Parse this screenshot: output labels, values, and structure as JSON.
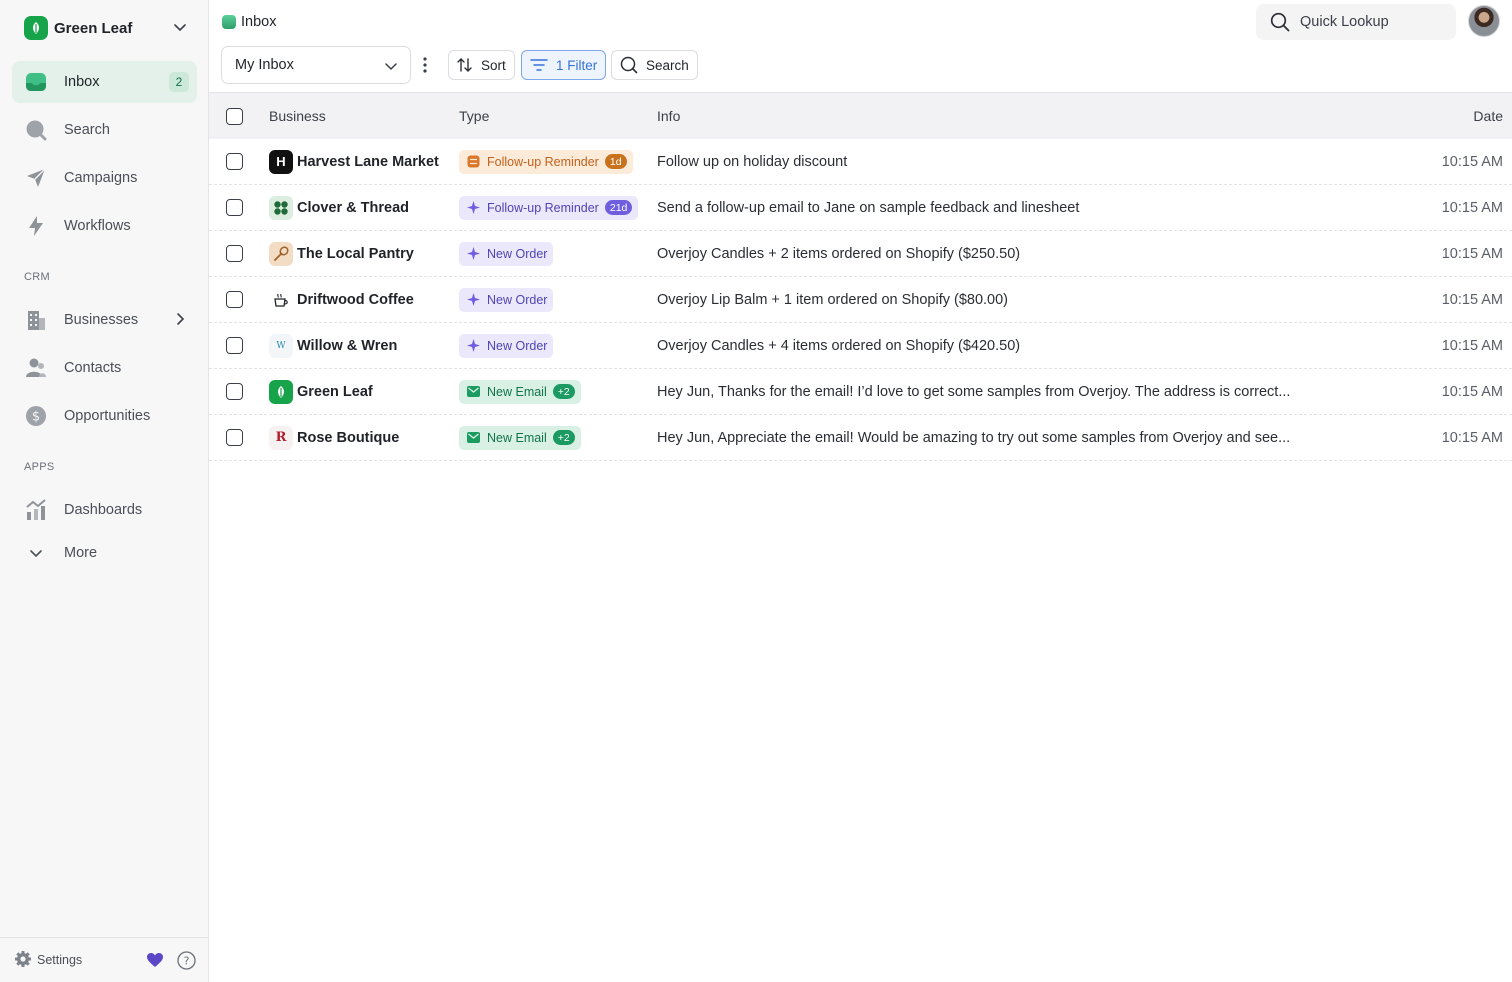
{
  "org": {
    "name": "Green Leaf"
  },
  "sidebar": {
    "items": [
      {
        "label": "Inbox",
        "badge": "2"
      },
      {
        "label": "Search"
      },
      {
        "label": "Campaigns"
      },
      {
        "label": "Workflows"
      },
      {
        "label": "Businesses"
      },
      {
        "label": "Contacts"
      },
      {
        "label": "Opportunities"
      },
      {
        "label": "Dashboards"
      },
      {
        "label": "More"
      }
    ],
    "sections": {
      "crm": "CRM",
      "apps": "APPS"
    },
    "footer": {
      "settings": "Settings"
    }
  },
  "header": {
    "breadcrumb": "Inbox",
    "quick_lookup": "Quick Lookup"
  },
  "toolbar": {
    "inbox_select": "My Inbox",
    "sort": "Sort",
    "filter": "1 Filter",
    "search": "Search"
  },
  "table": {
    "columns": {
      "business": "Business",
      "type": "Type",
      "info": "Info",
      "date": "Date"
    },
    "rows": [
      {
        "business": "Harvest Lane Market",
        "logo_text": "H",
        "type": "Follow-up Reminder",
        "type_count": "1d",
        "info": "Follow up on holiday discount",
        "date": "10:15 AM"
      },
      {
        "business": "Clover & Thread",
        "type": "Follow-up Reminder",
        "type_count": "21d",
        "info": "Send a follow-up email to Jane on sample feedback and linesheet",
        "date": "10:15 AM"
      },
      {
        "business": "The Local Pantry",
        "type": "New Order",
        "info": "Overjoy Candles + 2 items ordered on Shopify ($250.50)",
        "date": "10:15 AM"
      },
      {
        "business": "Driftwood Coffee",
        "type": "New Order",
        "info": "Overjoy Lip Balm + 1 item ordered on Shopify ($80.00)",
        "date": "10:15 AM"
      },
      {
        "business": "Willow & Wren",
        "logo_text": "W",
        "type": "New Order",
        "info": "Overjoy Candles + 4 items ordered on Shopify ($420.50)",
        "date": "10:15 AM"
      },
      {
        "business": "Green Leaf",
        "type": "New Email",
        "type_count": "+2",
        "info": "Hey Jun, Thanks for the email! I’d love to get some samples from Overjoy. The address is correct...",
        "date": "10:15 AM"
      },
      {
        "business": "Rose Boutique",
        "logo_text": "R",
        "type": "New Email",
        "type_count": "+2",
        "info": "Hey Jun, Appreciate the email! Would be amazing to try out some samples from Overjoy and see...",
        "date": "10:15 AM"
      }
    ]
  },
  "colors": {
    "accent_green": "#16a34a",
    "active_nav_bg": "#e3f1ea",
    "filter_blue": "#3572d6",
    "pill_orange": "#c2611a",
    "pill_purple": "#4f45b6",
    "pill_green": "#127349"
  }
}
